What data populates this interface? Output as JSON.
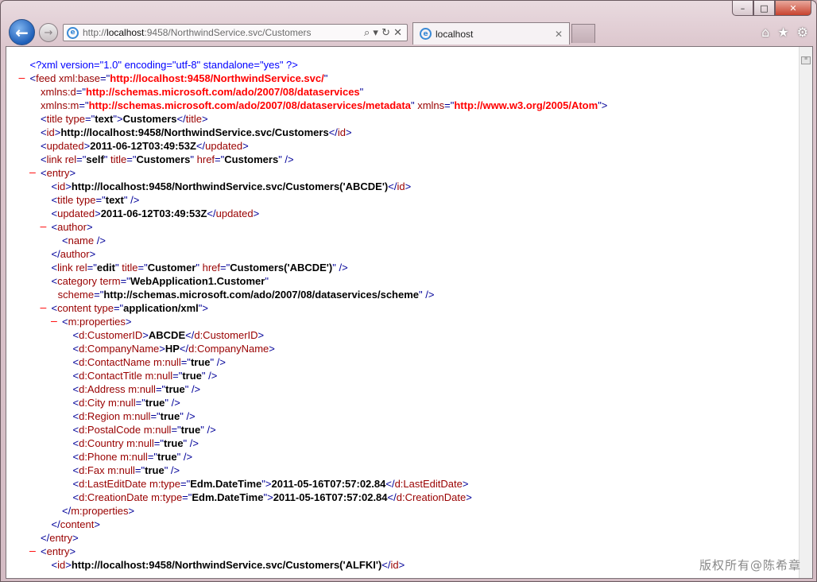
{
  "window": {
    "minimize_glyph": "–",
    "maximize_glyph": "□",
    "close_glyph": "✕"
  },
  "toolbar": {
    "back_glyph": "←",
    "forward_glyph": "→",
    "address_prefix": "http://",
    "address_host": "localhost",
    "address_rest": ":9458/NorthwindService.svc/Customers",
    "address_tools": "⌕ ▾ ↻ ✕",
    "tab_label": "localhost",
    "tab_close": "✕",
    "home_glyph": "⌂",
    "favorites_glyph": "★",
    "tools_glyph": "⚙"
  },
  "xml_lines": [
    {
      "indent": 1,
      "minus": false,
      "tokens": [
        [
          "pi",
          "<?xml version=\"1.0\" encoding=\"utf-8\" standalone=\"yes\" ?>"
        ]
      ]
    },
    {
      "indent": 1,
      "minus": true,
      "tokens": [
        [
          "t",
          "<"
        ],
        [
          "tn",
          "feed"
        ],
        [
          "an",
          " xml:base"
        ],
        [
          "t",
          "=\""
        ],
        [
          "ns",
          "http://localhost:9458/NorthwindService.svc/"
        ],
        [
          "t",
          "\""
        ]
      ]
    },
    {
      "indent": 2,
      "minus": false,
      "tokens": [
        [
          "an",
          "xmlns:d"
        ],
        [
          "t",
          "=\""
        ],
        [
          "ns",
          "http://schemas.microsoft.com/ado/2007/08/dataservices"
        ],
        [
          "t",
          "\""
        ]
      ]
    },
    {
      "indent": 2,
      "minus": false,
      "tokens": [
        [
          "an",
          "xmlns:m"
        ],
        [
          "t",
          "=\""
        ],
        [
          "ns",
          "http://schemas.microsoft.com/ado/2007/08/dataservices/metadata"
        ],
        [
          "t",
          "\""
        ],
        [
          "an",
          " xmlns"
        ],
        [
          "t",
          "=\""
        ],
        [
          "ns",
          "http://www.w3.org/2005/Atom"
        ],
        [
          "t",
          "\">"
        ]
      ]
    },
    {
      "indent": 2,
      "minus": false,
      "tokens": [
        [
          "t",
          "<"
        ],
        [
          "tn",
          "title"
        ],
        [
          "an",
          " type"
        ],
        [
          "t",
          "=\""
        ],
        [
          "av",
          "text"
        ],
        [
          "t",
          "\">"
        ],
        [
          "txt",
          "Customers"
        ],
        [
          "t",
          "</"
        ],
        [
          "tn",
          "title"
        ],
        [
          "t",
          ">"
        ]
      ]
    },
    {
      "indent": 2,
      "minus": false,
      "tokens": [
        [
          "t",
          "<"
        ],
        [
          "tn",
          "id"
        ],
        [
          "t",
          ">"
        ],
        [
          "txt",
          "http://localhost:9458/NorthwindService.svc/Customers"
        ],
        [
          "t",
          "</"
        ],
        [
          "tn",
          "id"
        ],
        [
          "t",
          ">"
        ]
      ]
    },
    {
      "indent": 2,
      "minus": false,
      "tokens": [
        [
          "t",
          "<"
        ],
        [
          "tn",
          "updated"
        ],
        [
          "t",
          ">"
        ],
        [
          "txt",
          "2011-06-12T03:49:53Z"
        ],
        [
          "t",
          "</"
        ],
        [
          "tn",
          "updated"
        ],
        [
          "t",
          ">"
        ]
      ]
    },
    {
      "indent": 2,
      "minus": false,
      "tokens": [
        [
          "t",
          "<"
        ],
        [
          "tn",
          "link"
        ],
        [
          "an",
          " rel"
        ],
        [
          "t",
          "=\""
        ],
        [
          "av",
          "self"
        ],
        [
          "t",
          "\""
        ],
        [
          "an",
          " title"
        ],
        [
          "t",
          "=\""
        ],
        [
          "av",
          "Customers"
        ],
        [
          "t",
          "\""
        ],
        [
          "an",
          " href"
        ],
        [
          "t",
          "=\""
        ],
        [
          "av",
          "Customers"
        ],
        [
          "t",
          "\" />"
        ]
      ]
    },
    {
      "indent": 2,
      "minus": true,
      "tokens": [
        [
          "t",
          "<"
        ],
        [
          "tn",
          "entry"
        ],
        [
          "t",
          ">"
        ]
      ]
    },
    {
      "indent": 3,
      "minus": false,
      "tokens": [
        [
          "t",
          "<"
        ],
        [
          "tn",
          "id"
        ],
        [
          "t",
          ">"
        ],
        [
          "txt",
          "http://localhost:9458/NorthwindService.svc/Customers('ABCDE')"
        ],
        [
          "t",
          "</"
        ],
        [
          "tn",
          "id"
        ],
        [
          "t",
          ">"
        ]
      ]
    },
    {
      "indent": 3,
      "minus": false,
      "tokens": [
        [
          "t",
          "<"
        ],
        [
          "tn",
          "title"
        ],
        [
          "an",
          " type"
        ],
        [
          "t",
          "=\""
        ],
        [
          "av",
          "text"
        ],
        [
          "t",
          "\" />"
        ]
      ]
    },
    {
      "indent": 3,
      "minus": false,
      "tokens": [
        [
          "t",
          "<"
        ],
        [
          "tn",
          "updated"
        ],
        [
          "t",
          ">"
        ],
        [
          "txt",
          "2011-06-12T03:49:53Z"
        ],
        [
          "t",
          "</"
        ],
        [
          "tn",
          "updated"
        ],
        [
          "t",
          ">"
        ]
      ]
    },
    {
      "indent": 3,
      "minus": true,
      "tokens": [
        [
          "t",
          "<"
        ],
        [
          "tn",
          "author"
        ],
        [
          "t",
          ">"
        ]
      ]
    },
    {
      "indent": 4,
      "minus": false,
      "tokens": [
        [
          "t",
          "<"
        ],
        [
          "tn",
          "name"
        ],
        [
          "t",
          " />"
        ]
      ]
    },
    {
      "indent": 3,
      "minus": false,
      "tokens": [
        [
          "t",
          "</"
        ],
        [
          "tn",
          "author"
        ],
        [
          "t",
          ">"
        ]
      ]
    },
    {
      "indent": 3,
      "minus": false,
      "tokens": [
        [
          "t",
          "<"
        ],
        [
          "tn",
          "link"
        ],
        [
          "an",
          " rel"
        ],
        [
          "t",
          "=\""
        ],
        [
          "av",
          "edit"
        ],
        [
          "t",
          "\""
        ],
        [
          "an",
          " title"
        ],
        [
          "t",
          "=\""
        ],
        [
          "av",
          "Customer"
        ],
        [
          "t",
          "\""
        ],
        [
          "an",
          " href"
        ],
        [
          "t",
          "=\""
        ],
        [
          "av",
          "Customers('ABCDE')"
        ],
        [
          "t",
          "\" />"
        ]
      ]
    },
    {
      "indent": 3,
      "minus": false,
      "tokens": [
        [
          "t",
          "<"
        ],
        [
          "tn",
          "category"
        ],
        [
          "an",
          " term"
        ],
        [
          "t",
          "=\""
        ],
        [
          "av",
          "WebApplication1.Customer"
        ],
        [
          "t",
          "\""
        ]
      ]
    },
    {
      "indent": 3.6,
      "minus": false,
      "tokens": [
        [
          "an",
          "scheme"
        ],
        [
          "t",
          "=\""
        ],
        [
          "av",
          "http://schemas.microsoft.com/ado/2007/08/dataservices/scheme"
        ],
        [
          "t",
          "\" />"
        ]
      ]
    },
    {
      "indent": 3,
      "minus": true,
      "tokens": [
        [
          "t",
          "<"
        ],
        [
          "tn",
          "content"
        ],
        [
          "an",
          " type"
        ],
        [
          "t",
          "=\""
        ],
        [
          "av",
          "application/xml"
        ],
        [
          "t",
          "\">"
        ]
      ]
    },
    {
      "indent": 4,
      "minus": true,
      "tokens": [
        [
          "t",
          "<"
        ],
        [
          "tn",
          "m:properties"
        ],
        [
          "t",
          ">"
        ]
      ]
    },
    {
      "indent": 5,
      "minus": false,
      "tokens": [
        [
          "t",
          "<"
        ],
        [
          "tn",
          "d:CustomerID"
        ],
        [
          "t",
          ">"
        ],
        [
          "txt",
          "ABCDE"
        ],
        [
          "t",
          "</"
        ],
        [
          "tn",
          "d:CustomerID"
        ],
        [
          "t",
          ">"
        ]
      ]
    },
    {
      "indent": 5,
      "minus": false,
      "tokens": [
        [
          "t",
          "<"
        ],
        [
          "tn",
          "d:CompanyName"
        ],
        [
          "t",
          ">"
        ],
        [
          "txt",
          "HP"
        ],
        [
          "t",
          "</"
        ],
        [
          "tn",
          "d:CompanyName"
        ],
        [
          "t",
          ">"
        ]
      ]
    },
    {
      "indent": 5,
      "minus": false,
      "tokens": [
        [
          "t",
          "<"
        ],
        [
          "tn",
          "d:ContactName"
        ],
        [
          "an",
          " m:null"
        ],
        [
          "t",
          "=\""
        ],
        [
          "av",
          "true"
        ],
        [
          "t",
          "\" />"
        ]
      ]
    },
    {
      "indent": 5,
      "minus": false,
      "tokens": [
        [
          "t",
          "<"
        ],
        [
          "tn",
          "d:ContactTitle"
        ],
        [
          "an",
          " m:null"
        ],
        [
          "t",
          "=\""
        ],
        [
          "av",
          "true"
        ],
        [
          "t",
          "\" />"
        ]
      ]
    },
    {
      "indent": 5,
      "minus": false,
      "tokens": [
        [
          "t",
          "<"
        ],
        [
          "tn",
          "d:Address"
        ],
        [
          "an",
          " m:null"
        ],
        [
          "t",
          "=\""
        ],
        [
          "av",
          "true"
        ],
        [
          "t",
          "\" />"
        ]
      ]
    },
    {
      "indent": 5,
      "minus": false,
      "tokens": [
        [
          "t",
          "<"
        ],
        [
          "tn",
          "d:City"
        ],
        [
          "an",
          " m:null"
        ],
        [
          "t",
          "=\""
        ],
        [
          "av",
          "true"
        ],
        [
          "t",
          "\" />"
        ]
      ]
    },
    {
      "indent": 5,
      "minus": false,
      "tokens": [
        [
          "t",
          "<"
        ],
        [
          "tn",
          "d:Region"
        ],
        [
          "an",
          " m:null"
        ],
        [
          "t",
          "=\""
        ],
        [
          "av",
          "true"
        ],
        [
          "t",
          "\" />"
        ]
      ]
    },
    {
      "indent": 5,
      "minus": false,
      "tokens": [
        [
          "t",
          "<"
        ],
        [
          "tn",
          "d:PostalCode"
        ],
        [
          "an",
          " m:null"
        ],
        [
          "t",
          "=\""
        ],
        [
          "av",
          "true"
        ],
        [
          "t",
          "\" />"
        ]
      ]
    },
    {
      "indent": 5,
      "minus": false,
      "tokens": [
        [
          "t",
          "<"
        ],
        [
          "tn",
          "d:Country"
        ],
        [
          "an",
          " m:null"
        ],
        [
          "t",
          "=\""
        ],
        [
          "av",
          "true"
        ],
        [
          "t",
          "\" />"
        ]
      ]
    },
    {
      "indent": 5,
      "minus": false,
      "tokens": [
        [
          "t",
          "<"
        ],
        [
          "tn",
          "d:Phone"
        ],
        [
          "an",
          " m:null"
        ],
        [
          "t",
          "=\""
        ],
        [
          "av",
          "true"
        ],
        [
          "t",
          "\" />"
        ]
      ]
    },
    {
      "indent": 5,
      "minus": false,
      "tokens": [
        [
          "t",
          "<"
        ],
        [
          "tn",
          "d:Fax"
        ],
        [
          "an",
          " m:null"
        ],
        [
          "t",
          "=\""
        ],
        [
          "av",
          "true"
        ],
        [
          "t",
          "\" />"
        ]
      ]
    },
    {
      "indent": 5,
      "minus": false,
      "tokens": [
        [
          "t",
          "<"
        ],
        [
          "tn",
          "d:LastEditDate"
        ],
        [
          "an",
          " m:type"
        ],
        [
          "t",
          "=\""
        ],
        [
          "av",
          "Edm.DateTime"
        ],
        [
          "t",
          "\">"
        ],
        [
          "txt",
          "2011-05-16T07:57:02.84"
        ],
        [
          "t",
          "</"
        ],
        [
          "tn",
          "d:LastEditDate"
        ],
        [
          "t",
          ">"
        ]
      ]
    },
    {
      "indent": 5,
      "minus": false,
      "tokens": [
        [
          "t",
          "<"
        ],
        [
          "tn",
          "d:CreationDate"
        ],
        [
          "an",
          " m:type"
        ],
        [
          "t",
          "=\""
        ],
        [
          "av",
          "Edm.DateTime"
        ],
        [
          "t",
          "\">"
        ],
        [
          "txt",
          "2011-05-16T07:57:02.84"
        ],
        [
          "t",
          "</"
        ],
        [
          "tn",
          "d:CreationDate"
        ],
        [
          "t",
          ">"
        ]
      ]
    },
    {
      "indent": 4,
      "minus": false,
      "tokens": [
        [
          "t",
          "</"
        ],
        [
          "tn",
          "m:properties"
        ],
        [
          "t",
          ">"
        ]
      ]
    },
    {
      "indent": 3,
      "minus": false,
      "tokens": [
        [
          "t",
          "</"
        ],
        [
          "tn",
          "content"
        ],
        [
          "t",
          ">"
        ]
      ]
    },
    {
      "indent": 2,
      "minus": false,
      "tokens": [
        [
          "t",
          "</"
        ],
        [
          "tn",
          "entry"
        ],
        [
          "t",
          ">"
        ]
      ]
    },
    {
      "indent": 2,
      "minus": true,
      "tokens": [
        [
          "t",
          "<"
        ],
        [
          "tn",
          "entry"
        ],
        [
          "t",
          ">"
        ]
      ]
    },
    {
      "indent": 3,
      "minus": false,
      "tokens": [
        [
          "t",
          "<"
        ],
        [
          "tn",
          "id"
        ],
        [
          "t",
          ">"
        ],
        [
          "txt",
          "http://localhost:9458/NorthwindService.svc/Customers('ALFKI')"
        ],
        [
          "t",
          "</"
        ],
        [
          "tn",
          "id"
        ],
        [
          "t",
          ">"
        ]
      ]
    }
  ],
  "watermark": "版权所有@陈希章"
}
